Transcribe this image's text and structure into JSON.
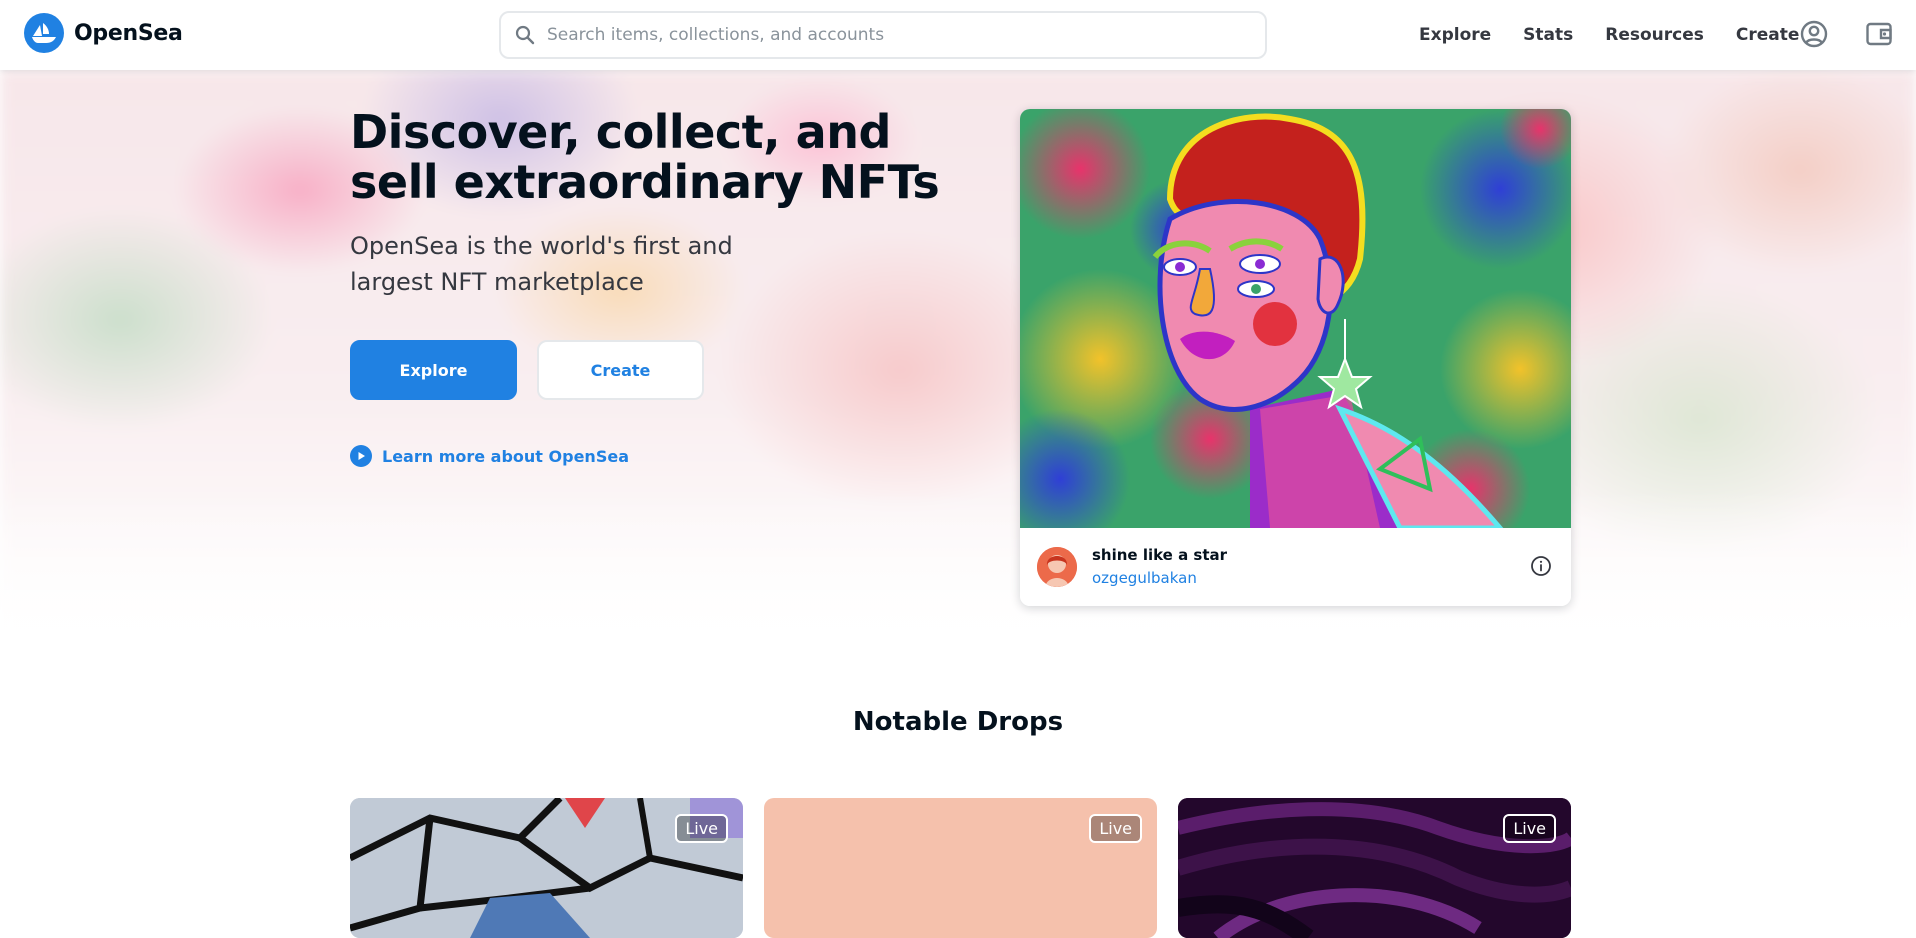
{
  "header": {
    "logo_text": "OpenSea",
    "search_placeholder": "Search items, collections, and accounts",
    "nav": [
      "Explore",
      "Stats",
      "Resources",
      "Create"
    ],
    "icons": [
      "account-icon",
      "wallet-icon"
    ]
  },
  "hero": {
    "title": "Discover, collect, and sell extraordinary NFTs",
    "subtitle": "OpenSea is the world's first and largest NFT marketplace",
    "explore_label": "Explore",
    "create_label": "Create",
    "learn_more_label": "Learn more about OpenSea"
  },
  "featured": {
    "name": "shine like a star",
    "creator": "ozgegulbakan"
  },
  "notable_drops": {
    "title": "Notable Drops",
    "items": [
      {
        "badge": "Live"
      },
      {
        "badge": "Live"
      },
      {
        "badge": "Live"
      }
    ]
  },
  "colors": {
    "brand": "#2081e2",
    "text_primary": "#04111d",
    "text_secondary": "#353840",
    "border": "#e5e8eb"
  }
}
